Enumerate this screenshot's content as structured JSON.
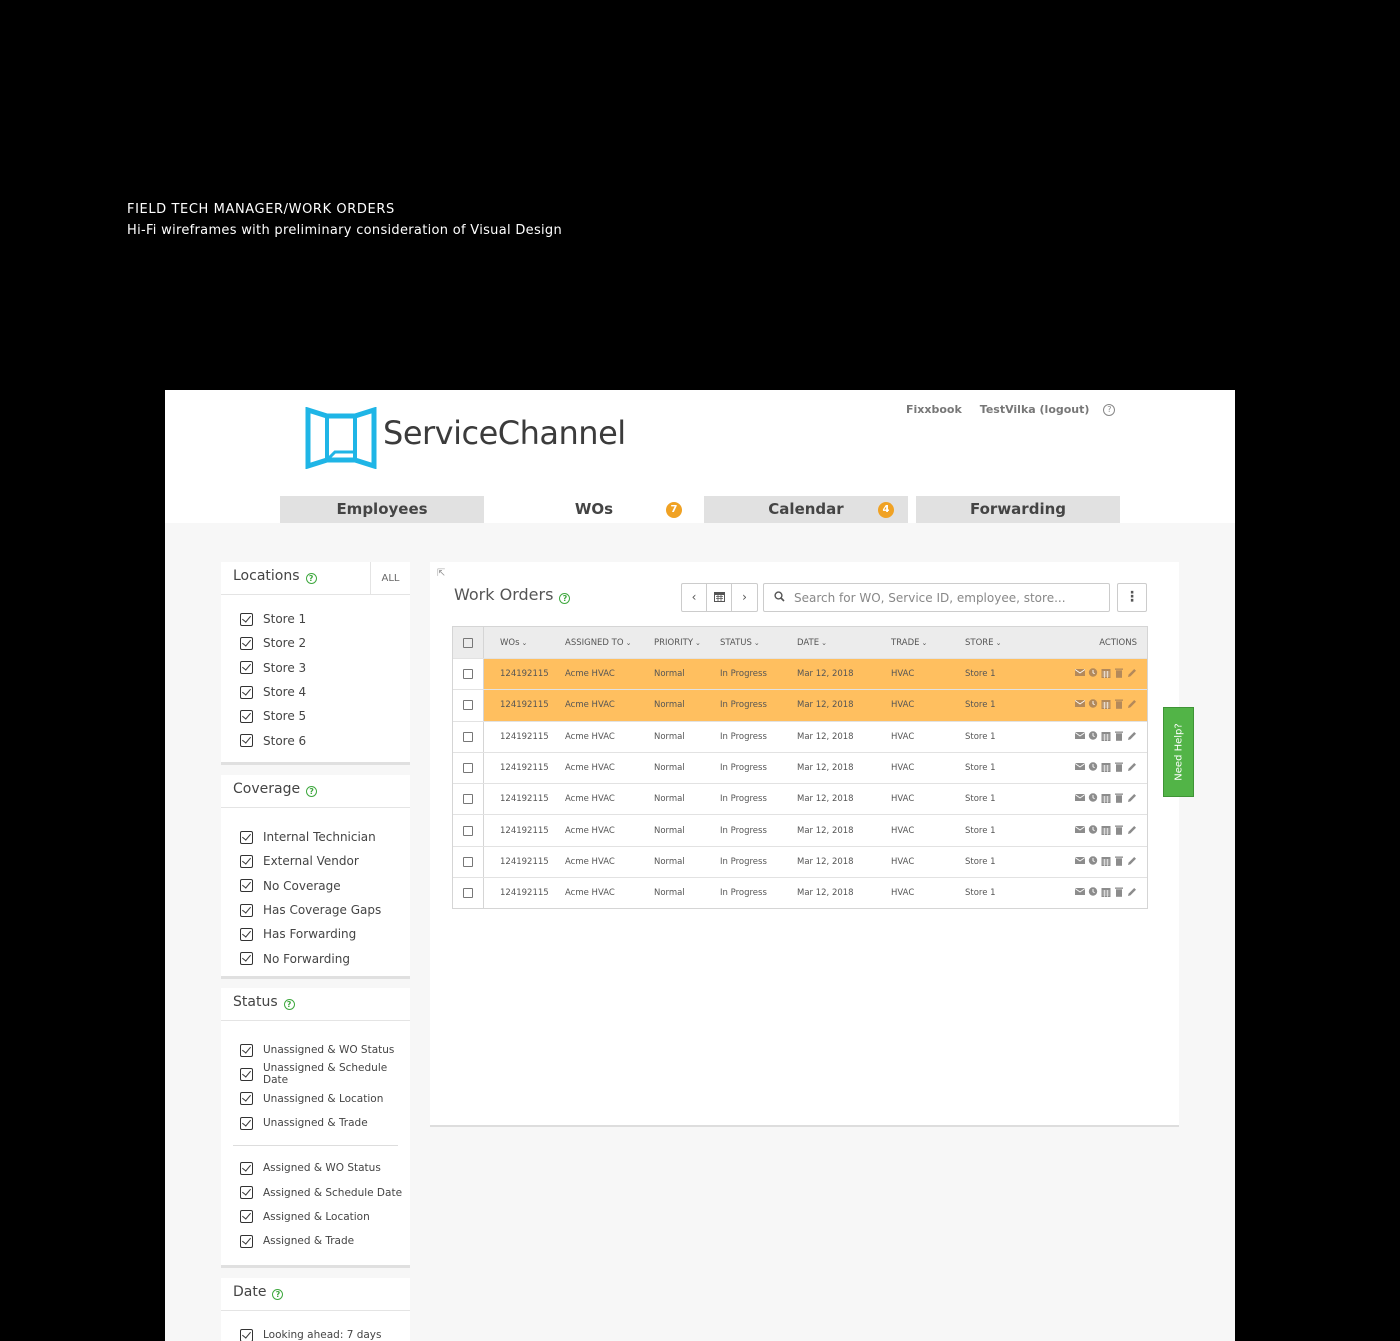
{
  "caption": {
    "title": "FIELD TECH MANAGER/WORK ORDERS",
    "subtitle": "Hi-Fi wireframes with preliminary consideration of Visual Design"
  },
  "header": {
    "brand": "ServiceChannel",
    "links": [
      "Fixxbook",
      "TestVilka (logout)"
    ],
    "help_icon": "?"
  },
  "tabs": [
    {
      "label": "Employees",
      "badge": null
    },
    {
      "label": "WOs",
      "badge": "7",
      "active": true
    },
    {
      "label": "Calendar",
      "badge": "4"
    },
    {
      "label": "Forwarding",
      "badge": null
    }
  ],
  "filters": {
    "locations": {
      "title": "Locations",
      "all_label": "ALL",
      "items": [
        "Store 1",
        "Store 2",
        "Store 3",
        "Store 4",
        "Store 5",
        "Store 6"
      ]
    },
    "coverage": {
      "title": "Coverage",
      "items": [
        "Internal Technician",
        "External Vendor",
        "No Coverage",
        "Has Coverage Gaps",
        "Has Forwarding",
        "No Forwarding"
      ]
    },
    "status": {
      "title": "Status",
      "group1": [
        "Unassigned & WO Status",
        "Unassigned & Schedule Date",
        "Unassigned & Location",
        "Unassigned & Trade"
      ],
      "group2": [
        "Assigned & WO Status",
        "Assigned & Schedule Date",
        "Assigned & Location",
        "Assigned & Trade"
      ]
    },
    "date": {
      "title": "Date",
      "items": [
        "Looking ahead: 7 days"
      ]
    }
  },
  "work_orders": {
    "title": "Work Orders",
    "search_placeholder": "Search for WO, Service ID, employee, store...",
    "columns": [
      "WOs",
      "ASSIGNED TO",
      "PRIORITY",
      "STATUS",
      "DATE",
      "TRADE",
      "STORE",
      "ACTIONS"
    ],
    "rows": [
      {
        "wo": "124192115",
        "assigned": "Acme HVAC",
        "priority": "Normal",
        "status": "In Progress",
        "date": "Mar 12, 2018",
        "trade": "HVAC",
        "store": "Store 1",
        "highlight": true
      },
      {
        "wo": "124192115",
        "assigned": "Acme HVAC",
        "priority": "Normal",
        "status": "In Progress",
        "date": "Mar 12, 2018",
        "trade": "HVAC",
        "store": "Store 1",
        "highlight": true
      },
      {
        "wo": "124192115",
        "assigned": "Acme HVAC",
        "priority": "Normal",
        "status": "In Progress",
        "date": "Mar 12, 2018",
        "trade": "HVAC",
        "store": "Store 1",
        "highlight": false
      },
      {
        "wo": "124192115",
        "assigned": "Acme HVAC",
        "priority": "Normal",
        "status": "In Progress",
        "date": "Mar 12, 2018",
        "trade": "HVAC",
        "store": "Store 1",
        "highlight": false
      },
      {
        "wo": "124192115",
        "assigned": "Acme HVAC",
        "priority": "Normal",
        "status": "In Progress",
        "date": "Mar 12, 2018",
        "trade": "HVAC",
        "store": "Store 1",
        "highlight": false
      },
      {
        "wo": "124192115",
        "assigned": "Acme HVAC",
        "priority": "Normal",
        "status": "In Progress",
        "date": "Mar 12, 2018",
        "trade": "HVAC",
        "store": "Store 1",
        "highlight": false
      },
      {
        "wo": "124192115",
        "assigned": "Acme HVAC",
        "priority": "Normal",
        "status": "In Progress",
        "date": "Mar 12, 2018",
        "trade": "HVAC",
        "store": "Store 1",
        "highlight": false
      },
      {
        "wo": "124192115",
        "assigned": "Acme HVAC",
        "priority": "Normal",
        "status": "In Progress",
        "date": "Mar 12, 2018",
        "trade": "HVAC",
        "store": "Store 1",
        "highlight": false
      }
    ],
    "action_icons": [
      "mail-icon",
      "clock-icon",
      "calendar-icon",
      "trash-icon",
      "pencil-icon"
    ]
  },
  "need_help": "Need Help?",
  "colors": {
    "highlight": "#ffbf5f",
    "badge": "#f0a224",
    "logo": "#1fb5e6",
    "help_green": "#52b447"
  }
}
